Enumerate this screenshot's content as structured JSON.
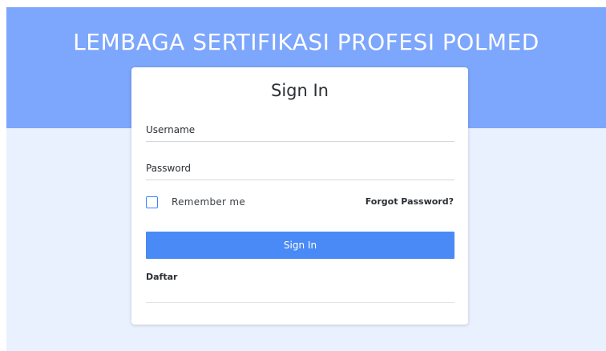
{
  "header": {
    "title": "LEMBAGA SERTIFIKASI PROFESI POLMED"
  },
  "login": {
    "title": "Sign In",
    "username_placeholder": "Username",
    "password_placeholder": "Password",
    "remember_label": "Remember me",
    "remember_checked": false,
    "forgot_label": "Forgot Password?",
    "submit_label": "Sign In",
    "register_label": "Daftar"
  },
  "colors": {
    "header_bg": "#7da6fd",
    "page_bg": "#eaf1fe",
    "button_bg": "#4a8af6",
    "checkbox_border": "#3b82f6"
  }
}
